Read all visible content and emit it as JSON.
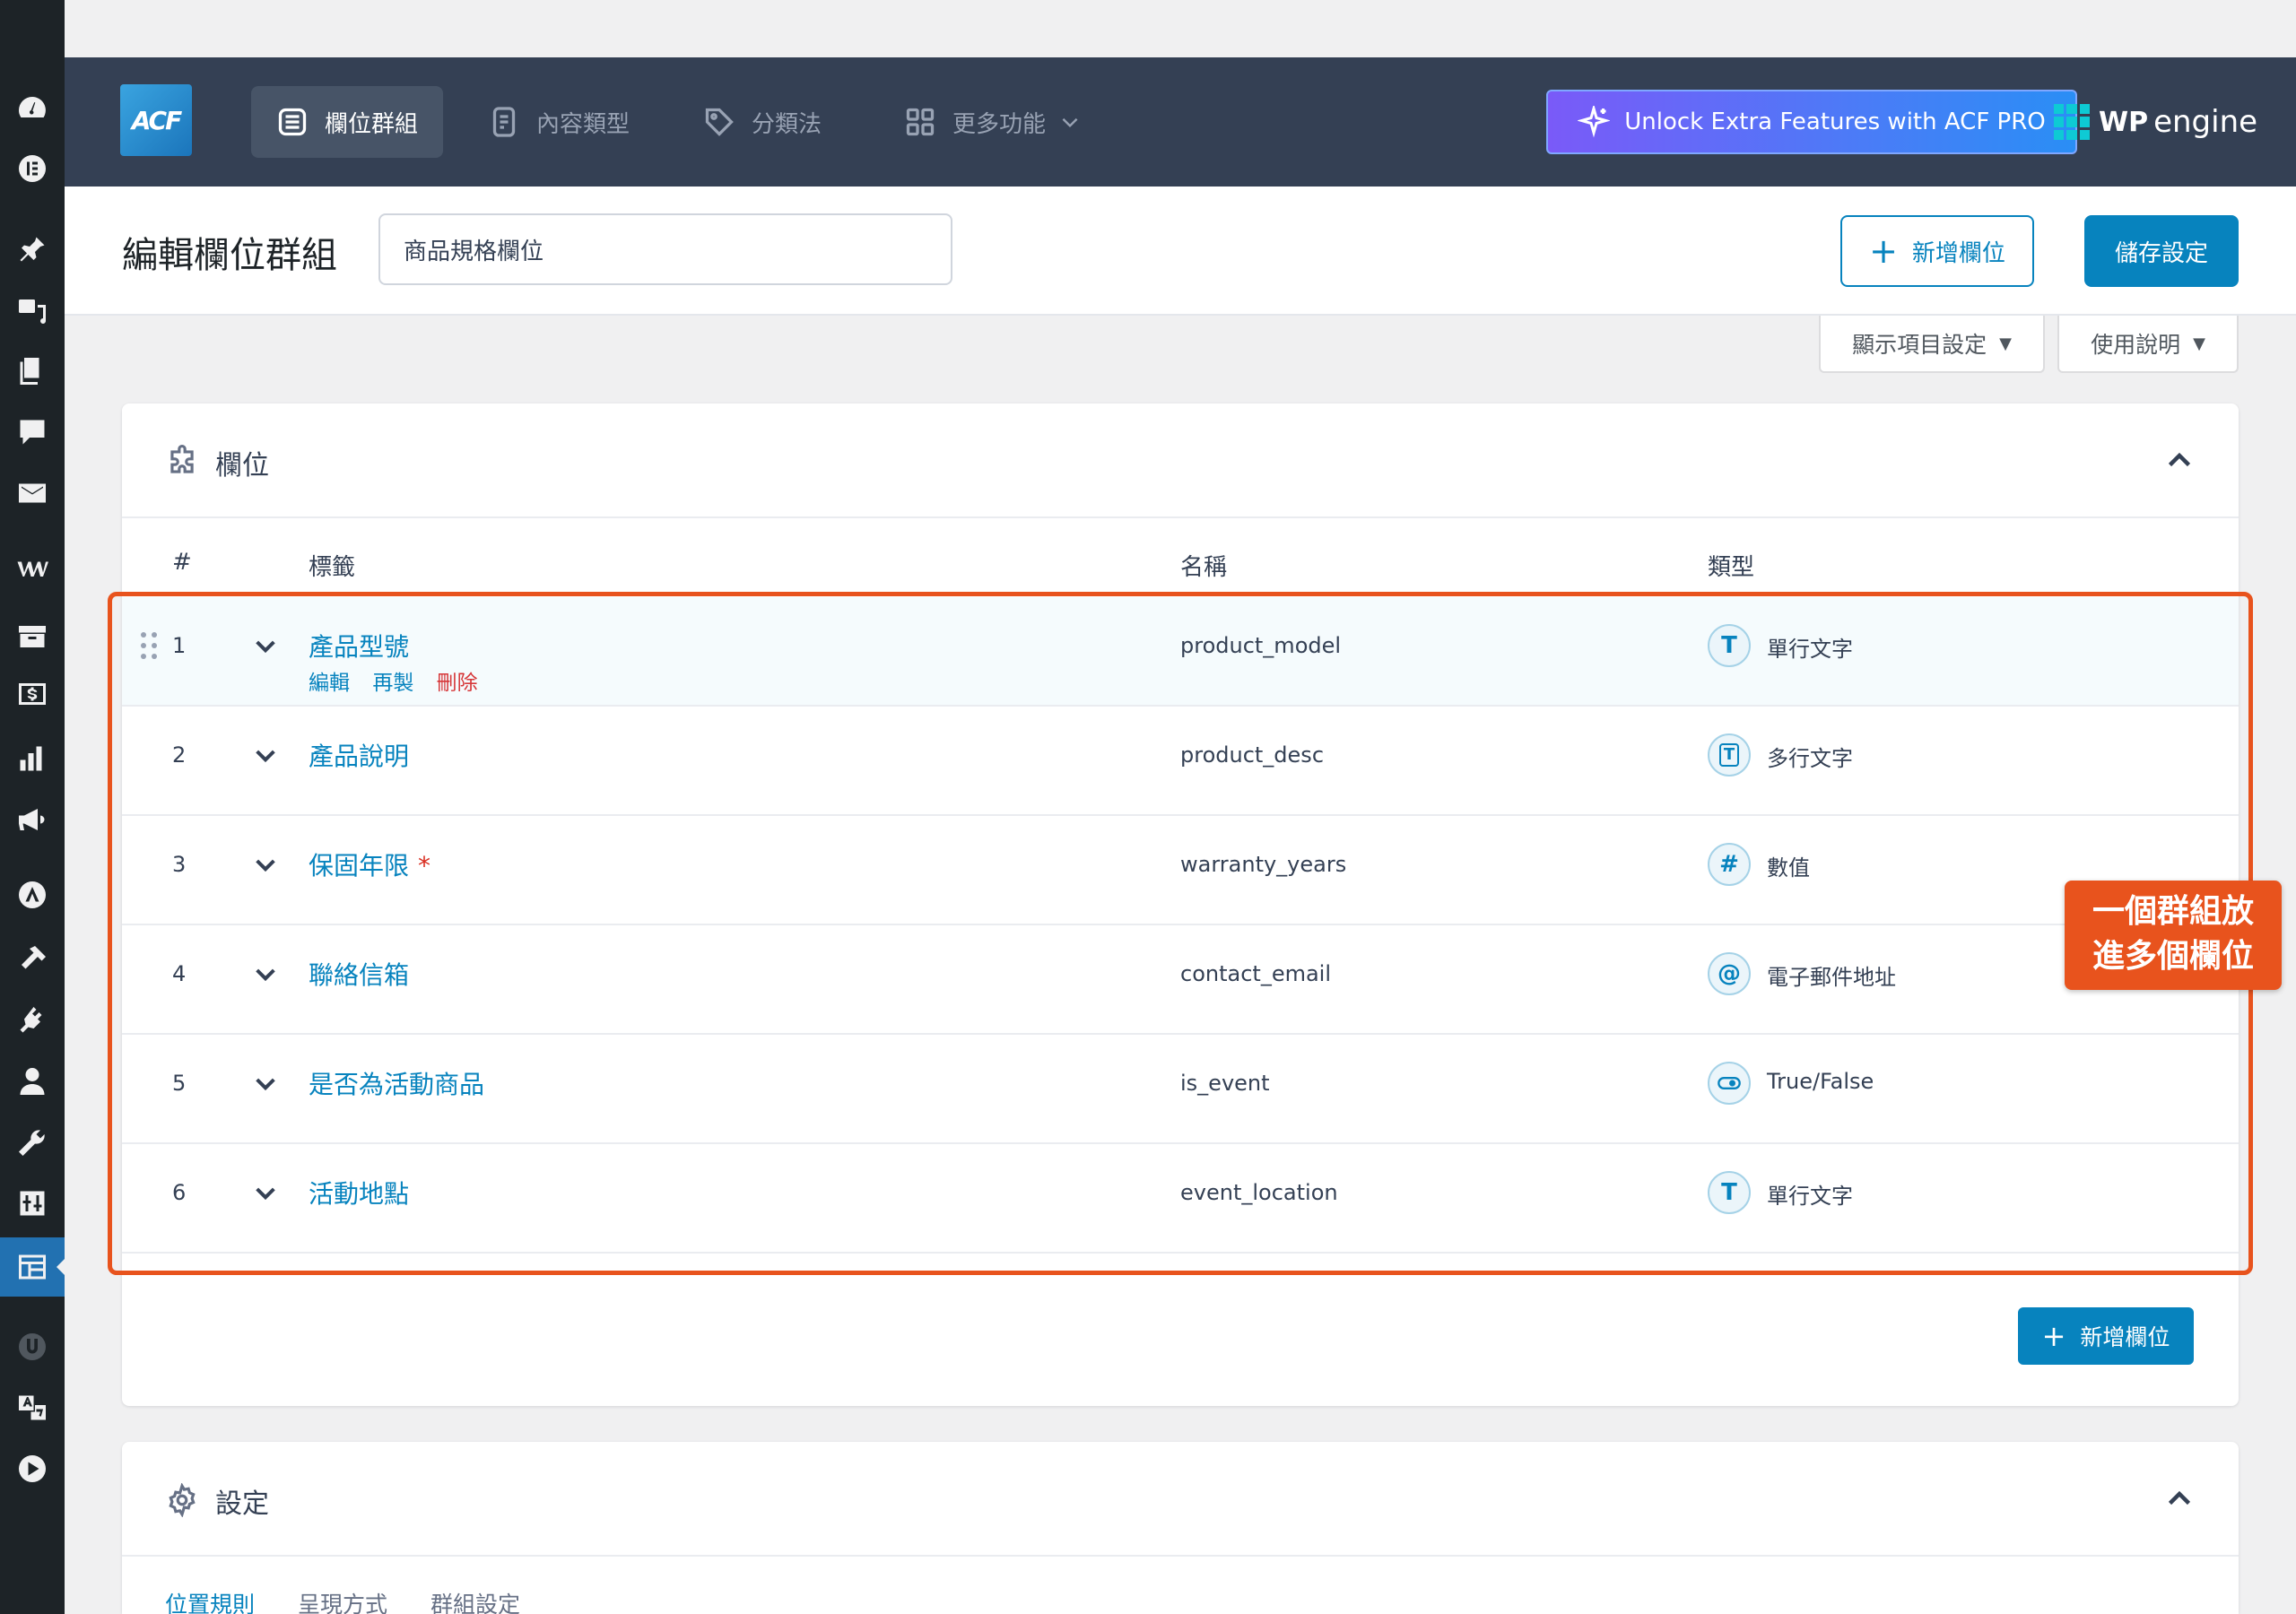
{
  "header": {
    "logo": "ACF",
    "nav": [
      {
        "label": "欄位群組",
        "icon": "field-group-icon",
        "active": true
      },
      {
        "label": "內容類型",
        "icon": "post-type-icon",
        "active": false
      },
      {
        "label": "分類法",
        "icon": "tag-icon",
        "active": false
      },
      {
        "label": "更多功能",
        "icon": "grid-icon",
        "active": false
      }
    ],
    "pro_button": "Unlock Extra Features with ACF PRO",
    "partner_bold": "WP",
    "partner_text": "engine"
  },
  "title_bar": {
    "title": "編輯欄位群組",
    "group_name": "商品規格欄位",
    "add_field": "新增欄位",
    "save": "儲存設定"
  },
  "screen_tabs": {
    "screen_options": "顯示項目設定",
    "help": "使用說明"
  },
  "fields_panel": {
    "title": "欄位",
    "columns": {
      "num": "#",
      "label": "標籤",
      "name": "名稱",
      "type": "類型"
    },
    "row_actions": {
      "edit": "編輯",
      "duplicate": "再製",
      "delete": "刪除"
    },
    "rows": [
      {
        "num": "1",
        "label": "產品型號",
        "name": "product_model",
        "type": "單行文字",
        "type_glyph": "T",
        "required": ""
      },
      {
        "num": "2",
        "label": "產品說明",
        "name": "product_desc",
        "type": "多行文字",
        "type_glyph": "T",
        "required": ""
      },
      {
        "num": "3",
        "label": "保固年限",
        "name": "warranty_years",
        "type": "數值",
        "type_glyph": "#",
        "required": "*"
      },
      {
        "num": "4",
        "label": "聯絡信箱",
        "name": "contact_email",
        "type": "電子郵件地址",
        "type_glyph": "@",
        "required": ""
      },
      {
        "num": "5",
        "label": "是否為活動商品",
        "name": "is_event",
        "type": "True/False",
        "type_glyph": "◉",
        "required": ""
      },
      {
        "num": "6",
        "label": "活動地點",
        "name": "event_location",
        "type": "單行文字",
        "type_glyph": "T",
        "required": ""
      }
    ],
    "add_field": "新增欄位"
  },
  "callout": {
    "line1": "一個群組放",
    "line2": "進多個欄位"
  },
  "settings_panel": {
    "title": "設定",
    "tabs": [
      "位置規則",
      "呈現方式",
      "群組設定"
    ]
  },
  "colors": {
    "accent": "#0783be",
    "header_bg": "#344054",
    "highlight": "#e8531d",
    "sidebar_bg": "#1d2327"
  }
}
